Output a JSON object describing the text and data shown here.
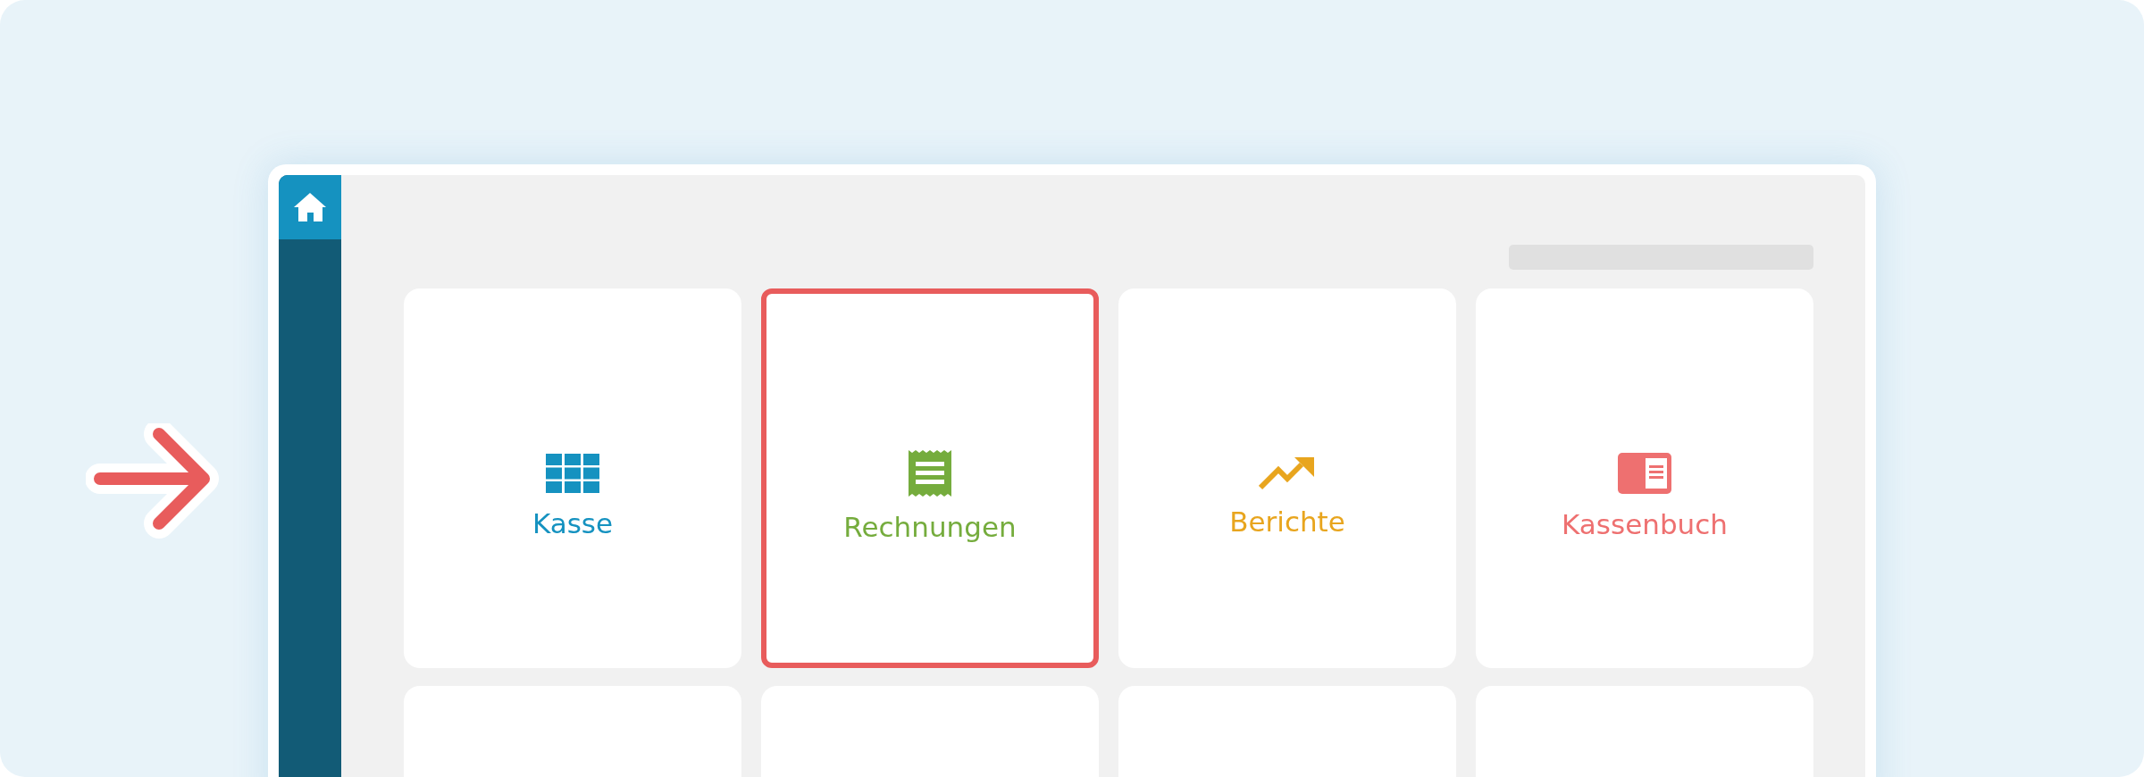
{
  "sidebar": {
    "home_selected": true
  },
  "tiles": [
    {
      "kind": "grid",
      "label": "Kasse",
      "color": "#1592c0",
      "selected": false
    },
    {
      "kind": "receipt",
      "label": "Rechnungen",
      "color": "#75ac3d",
      "selected": true
    },
    {
      "kind": "trend",
      "label": "Berichte",
      "color": "#e8a51e",
      "selected": false
    },
    {
      "kind": "book",
      "label": "Kassenbuch",
      "color": "#ee7070",
      "selected": false
    },
    {
      "kind": "empty",
      "selected": false
    },
    {
      "kind": "empty",
      "selected": false
    },
    {
      "kind": "empty",
      "selected": false
    },
    {
      "kind": "empty",
      "selected": false
    }
  ]
}
